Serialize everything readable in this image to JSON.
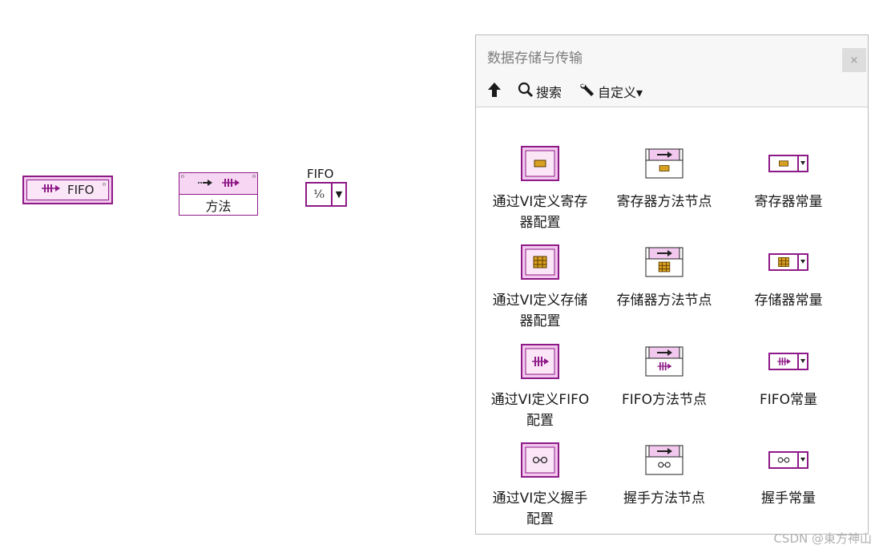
{
  "diagram": {
    "fifo_ref": {
      "glyph": "⫞⫞→",
      "label": "FIFO",
      "tag": "ᴰ"
    },
    "method_node": {
      "label": "方法"
    },
    "constant": {
      "label": "FIFO",
      "value": "⅟₀",
      "drop": "▼"
    }
  },
  "palette": {
    "title": "数据存储与传输",
    "close": "×",
    "toolbar": {
      "up": "↑",
      "search": "搜索",
      "customize": "自定义▾"
    },
    "items": [
      {
        "label": "通过VI定义寄存器配置",
        "icon": "register-config-icon"
      },
      {
        "label": "寄存器方法节点",
        "icon": "register-method-icon"
      },
      {
        "label": "寄存器常量",
        "icon": "register-constant-icon"
      },
      {
        "label": "通过VI定义存储器配置",
        "icon": "memory-config-icon"
      },
      {
        "label": "存储器方法节点",
        "icon": "memory-method-icon"
      },
      {
        "label": "存储器常量",
        "icon": "memory-constant-icon"
      },
      {
        "label": "通过VI定义FIFO配置",
        "icon": "fifo-config-icon"
      },
      {
        "label": "FIFO方法节点",
        "icon": "fifo-method-icon"
      },
      {
        "label": "FIFO常量",
        "icon": "fifo-constant-icon"
      },
      {
        "label": "通过VI定义握手配置",
        "icon": "handshake-config-icon"
      },
      {
        "label": "握手方法节点",
        "icon": "handshake-method-icon"
      },
      {
        "label": "握手常量",
        "icon": "handshake-constant-icon"
      }
    ],
    "colors": {
      "accent": "#8e1a87",
      "accent_fill": "#f2c8ee",
      "bg": "#f7f7f7"
    }
  },
  "watermark": "CSDN @東方神山"
}
